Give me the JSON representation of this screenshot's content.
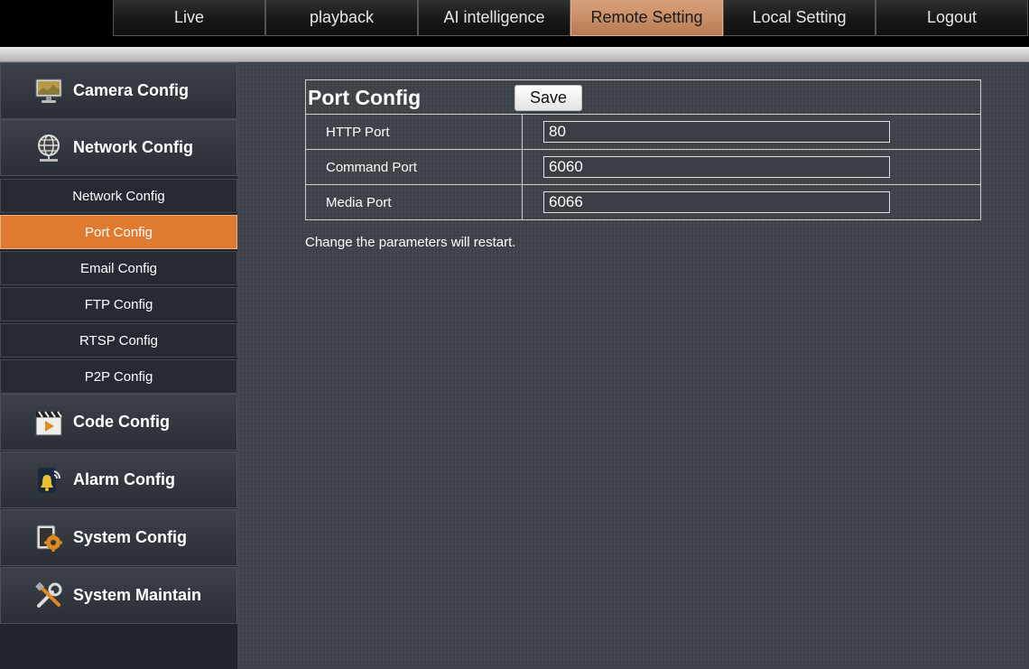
{
  "topnav": {
    "items": [
      {
        "label": "Live"
      },
      {
        "label": "playback"
      },
      {
        "label": "AI intelligence"
      },
      {
        "label": "Remote Setting",
        "active": true
      },
      {
        "label": "Local Setting"
      },
      {
        "label": "Logout"
      }
    ]
  },
  "sidebar": {
    "categories": {
      "camera": {
        "label": "Camera Config",
        "icon": "monitor-icon"
      },
      "network": {
        "label": "Network Config",
        "icon": "network-globe-icon"
      },
      "code": {
        "label": "Code Config",
        "icon": "clapperboard-icon"
      },
      "alarm": {
        "label": "Alarm Config",
        "icon": "alarm-bell-icon"
      },
      "system": {
        "label": "System Config",
        "icon": "system-gear-icon"
      },
      "maintain": {
        "label": "System Maintain",
        "icon": "wrench-tools-icon"
      }
    },
    "network_subitems": [
      {
        "label": "Network Config"
      },
      {
        "label": "Port Config",
        "active": true
      },
      {
        "label": "Email Config"
      },
      {
        "label": "FTP Config"
      },
      {
        "label": "RTSP Config"
      },
      {
        "label": "P2P Config"
      }
    ]
  },
  "main": {
    "title": "Port Config",
    "save_label": "Save",
    "rows": [
      {
        "label": "HTTP Port",
        "value": "80"
      },
      {
        "label": "Command Port",
        "value": "6060"
      },
      {
        "label": "Media Port",
        "value": "6066"
      }
    ],
    "note": "Change the parameters will restart."
  },
  "colors": {
    "accent_orange": "#e07a30",
    "active_tab": "#c98b61",
    "background": "#3d4148",
    "sidebar_bg": "#20252b"
  }
}
